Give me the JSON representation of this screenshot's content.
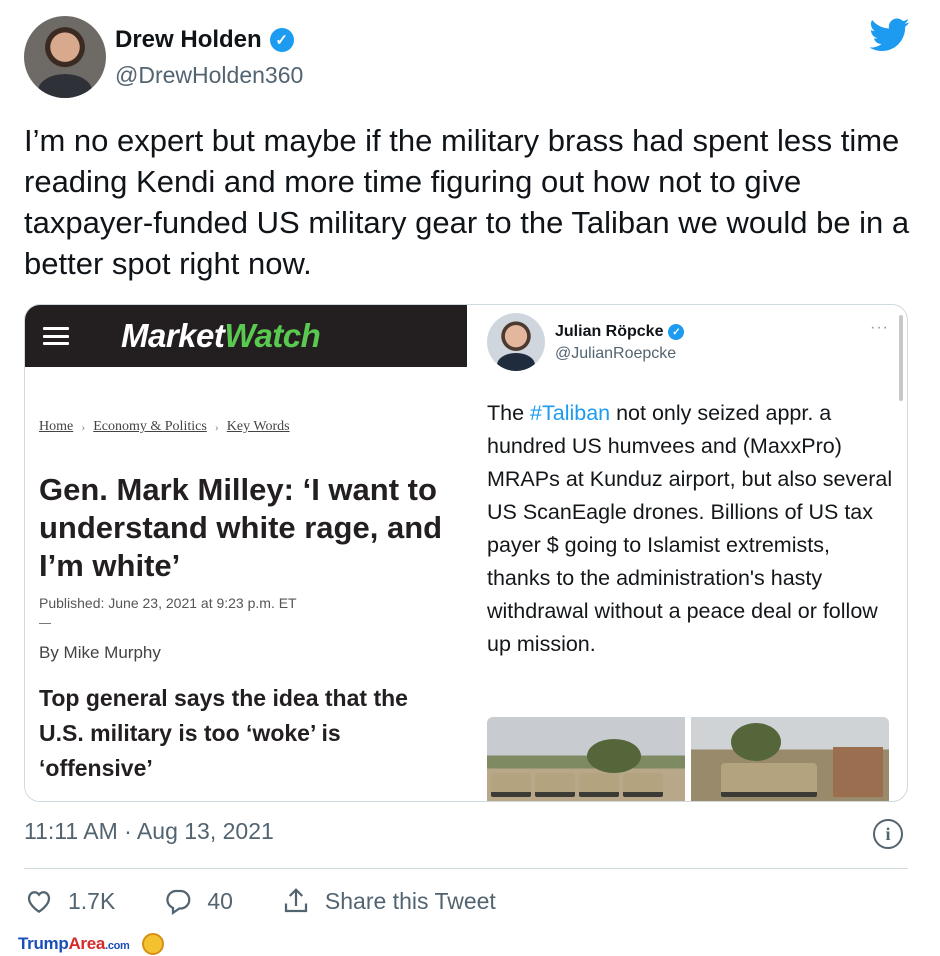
{
  "tweet": {
    "author_name": "Drew Holden",
    "author_handle": "@DrewHolden360",
    "text": "I’m no expert but maybe if the military brass had spent less time reading Kendi and more time figuring out how not to give taxpayer-funded US military gear to the Taliban we would be in a better spot right now.",
    "timestamp": "11:11 AM · Aug 13, 2021",
    "likes": "1.7K",
    "replies": "40",
    "share_label": "Share this Tweet"
  },
  "article": {
    "logo_part1": "Market",
    "logo_part2": "Watch",
    "breadcrumbs": [
      "Home",
      "Economy & Politics",
      "Key Words"
    ],
    "headline": "Gen. Mark Milley: ‘I want to understand white rage, and I’m white’",
    "published": "Published: June 23, 2021 at 9:23 p.m. ET",
    "byline": "By Mike Murphy",
    "subhead": "Top general says the idea that the U.S. military is too ‘woke’ is ‘offensive’"
  },
  "quoted_tweet": {
    "author_name": "Julian Röpcke",
    "author_handle": "@JulianRoepcke",
    "more": "···",
    "text_before": "The ",
    "hashtag": "#Taliban",
    "text_after": " not only seized appr. a hundred US humvees and (MaxxPro) MRAPs at Kunduz airport, but also several US ScanEagle drones. Billions of US tax payer $ going to Islamist extremists, thanks to the administration's hasty withdrawal without a peace deal or follow up mission."
  },
  "watermark": {
    "part1": "Trump",
    "part2": "Area",
    "part3": ".com"
  },
  "colors": {
    "twitter_blue": "#1d9bf0",
    "marketwatch_green": "#5ac94f",
    "marketwatch_bar": "#231f20",
    "secondary_text": "#536471"
  },
  "icons": [
    "verified-badge-icon",
    "twitter-bird-icon",
    "menu-icon",
    "info-icon",
    "heart-icon",
    "reply-icon",
    "share-icon"
  ]
}
